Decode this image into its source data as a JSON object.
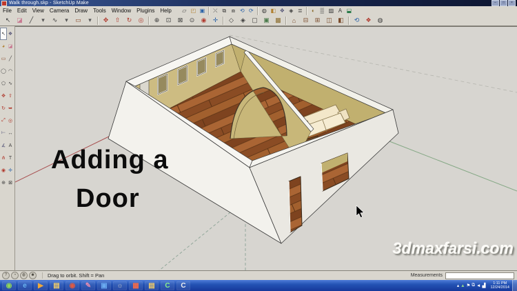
{
  "window": {
    "title": "Walk through.skp - SketchUp Make",
    "controls": [
      {
        "name": "minimize-button",
        "glyph": "–"
      },
      {
        "name": "maximize-button",
        "glyph": "□"
      },
      {
        "name": "close-button",
        "glyph": "×"
      }
    ]
  },
  "menu_bar": {
    "items": [
      {
        "name": "menu-file",
        "label": "File"
      },
      {
        "name": "menu-edit",
        "label": "Edit"
      },
      {
        "name": "menu-view",
        "label": "View"
      },
      {
        "name": "menu-camera",
        "label": "Camera"
      },
      {
        "name": "menu-draw",
        "label": "Draw"
      },
      {
        "name": "menu-tools",
        "label": "Tools"
      },
      {
        "name": "menu-window",
        "label": "Window"
      },
      {
        "name": "menu-plugins",
        "label": "Plugins"
      },
      {
        "name": "menu-help",
        "label": "Help"
      }
    ]
  },
  "toolbar_row1": {
    "icons": [
      {
        "name": "new-icon",
        "glyph": "▱"
      },
      {
        "name": "open-icon",
        "glyph": "◰",
        "color": "#b08030"
      },
      {
        "name": "save-icon",
        "glyph": "▣",
        "color": "#2a62a8"
      },
      {
        "sep": true,
        "name": "separator"
      },
      {
        "name": "cut-icon",
        "glyph": "⤫"
      },
      {
        "name": "copy-icon",
        "glyph": "⧉"
      },
      {
        "name": "paste-icon",
        "glyph": "⧈"
      },
      {
        "name": "undo-icon",
        "glyph": "⟲",
        "color": "#2a62a8"
      },
      {
        "name": "redo-icon",
        "glyph": "⟳",
        "color": "#2a62a8"
      },
      {
        "sep": true,
        "name": "separator"
      },
      {
        "name": "model-info-icon",
        "glyph": "◍"
      },
      {
        "name": "materials-icon",
        "glyph": "◧",
        "color": "#b08030"
      },
      {
        "name": "components-icon",
        "glyph": "❖",
        "color": "#555577"
      },
      {
        "name": "styles-icon",
        "glyph": "◈"
      },
      {
        "name": "layers-icon",
        "glyph": "≣"
      },
      {
        "sep": true,
        "name": "separator"
      },
      {
        "name": "shadows-icon",
        "glyph": "◐",
        "color": "#8a6a2a"
      },
      {
        "name": "fog-icon",
        "glyph": "▒"
      },
      {
        "name": "match-photo-icon",
        "glyph": "▨"
      },
      {
        "name": "text-tool-icon",
        "glyph": "A"
      },
      {
        "name": "section-plane-icon",
        "glyph": "⬓",
        "color": "#2a7a4a"
      }
    ]
  },
  "toolbar_row2": {
    "icons": [
      {
        "name": "select-icon",
        "glyph": "↖"
      },
      {
        "name": "eraser-icon",
        "glyph": "◪",
        "color": "#c87a92"
      },
      {
        "name": "line-icon",
        "glyph": "╱"
      },
      {
        "name": "dropdown-icon",
        "glyph": "▾",
        "color": "#555"
      },
      {
        "name": "freehand-icon",
        "glyph": "∿"
      },
      {
        "name": "dropdown-icon",
        "glyph": "▾",
        "color": "#555"
      },
      {
        "name": "rectangle-icon",
        "glyph": "▭",
        "color": "#8a4a2a"
      },
      {
        "name": "dropdown-icon",
        "glyph": "▾",
        "color": "#555"
      },
      {
        "sep": true,
        "name": "separator"
      },
      {
        "name": "move-icon",
        "glyph": "✥",
        "color": "#b03a2e"
      },
      {
        "name": "push-pull-icon",
        "glyph": "⇧",
        "color": "#b03a2e"
      },
      {
        "name": "rotate-icon",
        "glyph": "↻",
        "color": "#b03a2e"
      },
      {
        "name": "offset-icon",
        "glyph": "◎",
        "color": "#b03a2e"
      },
      {
        "sep": true,
        "name": "separator"
      },
      {
        "name": "zoom-in-icon",
        "glyph": "⊕"
      },
      {
        "name": "zoom-window-icon",
        "glyph": "⊡"
      },
      {
        "name": "zoom-extents-icon",
        "glyph": "⊠"
      },
      {
        "name": "zoom-previous-icon",
        "glyph": "⊙"
      },
      {
        "name": "orbit-icon",
        "glyph": "◉",
        "color": "#b03a2e"
      },
      {
        "name": "pan-icon",
        "glyph": "✛",
        "color": "#2a62a8"
      },
      {
        "sep": true,
        "name": "separator"
      },
      {
        "name": "xray-icon",
        "glyph": "◇"
      },
      {
        "name": "wireframe-icon",
        "glyph": "◈"
      },
      {
        "name": "hidden-line-icon",
        "glyph": "▢"
      },
      {
        "name": "shaded-icon",
        "glyph": "▣",
        "color": "#4a7a4a"
      },
      {
        "name": "textured-icon",
        "glyph": "▩",
        "color": "#8a6a2a"
      },
      {
        "sep": true,
        "name": "separator"
      },
      {
        "name": "iso-view-icon",
        "glyph": "⌂",
        "color": "#7a4a2a"
      },
      {
        "name": "top-view-icon",
        "glyph": "⊟",
        "color": "#7a4a2a"
      },
      {
        "name": "front-view-icon",
        "glyph": "⊞",
        "color": "#7a4a2a"
      },
      {
        "name": "right-view-icon",
        "glyph": "◫",
        "color": "#7a4a2a"
      },
      {
        "name": "back-view-icon",
        "glyph": "◧",
        "color": "#7a4a2a"
      },
      {
        "sep": true,
        "name": "separator"
      },
      {
        "name": "undo-view-icon",
        "glyph": "⟲",
        "color": "#2a62a8"
      },
      {
        "name": "make-component-icon",
        "glyph": "❖",
        "color": "#b03a2e"
      },
      {
        "name": "model-info-icon",
        "glyph": "◍"
      }
    ]
  },
  "left_toolbar": {
    "icons": [
      {
        "name": "select-icon",
        "glyph": "↖",
        "active": true
      },
      {
        "name": "make-component-icon",
        "glyph": "❖",
        "color": "#555577"
      },
      {
        "name": "paint-bucket-icon",
        "glyph": "◕",
        "color": "#b08030"
      },
      {
        "name": "eraser-icon",
        "glyph": "◪",
        "color": "#c87a92"
      },
      {
        "name": "rectangle-icon",
        "glyph": "▭",
        "color": "#8a4a2a"
      },
      {
        "name": "line-icon",
        "glyph": "╱"
      },
      {
        "name": "circle-icon",
        "glyph": "◯"
      },
      {
        "name": "arc-icon",
        "glyph": "◠"
      },
      {
        "name": "polygon-icon",
        "glyph": "⬠"
      },
      {
        "name": "freehand-icon",
        "glyph": "∿"
      },
      {
        "name": "move-icon",
        "glyph": "✥",
        "color": "#b03a2e"
      },
      {
        "name": "push-pull-icon",
        "glyph": "⇧",
        "color": "#b03a2e"
      },
      {
        "name": "rotate-icon",
        "glyph": "↻",
        "color": "#b03a2e"
      },
      {
        "name": "follow-me-icon",
        "glyph": "➥",
        "color": "#b03a2e"
      },
      {
        "name": "scale-icon",
        "glyph": "⤢",
        "color": "#b03a2e"
      },
      {
        "name": "offset-icon",
        "glyph": "◎",
        "color": "#b03a2e"
      },
      {
        "name": "tape-measure-icon",
        "glyph": "⟝",
        "color": "#555577"
      },
      {
        "name": "dimension-icon",
        "glyph": "↔"
      },
      {
        "name": "protractor-icon",
        "glyph": "∡",
        "color": "#555577"
      },
      {
        "name": "text-icon",
        "glyph": "A"
      },
      {
        "name": "axes-icon",
        "glyph": "⋔",
        "color": "#b03a2e"
      },
      {
        "name": "3d-text-icon",
        "glyph": "T"
      },
      {
        "name": "orbit-icon",
        "glyph": "◉",
        "color": "#b03a2e"
      },
      {
        "name": "pan-icon",
        "glyph": "✛",
        "color": "#2a62a8"
      },
      {
        "name": "zoom-icon",
        "glyph": "⊕"
      },
      {
        "name": "zoom-extents-icon",
        "glyph": "⊠"
      }
    ]
  },
  "canvas": {
    "overlay_title_line1": "Adding a",
    "overlay_title_line2": "Door",
    "watermark": "3dmaxfarsi.com",
    "colors": {
      "background": "#d7d5d0",
      "wall_interior_lit": "#cdbc82",
      "wall_interior_shaded": "#c1b06f",
      "wall_exterior": "#f3f2ed",
      "wall_rim": "#f7f6f2",
      "floor_wood_base": "#9a5a2c",
      "sofa_cream": "#f3e7c9",
      "table_brown": "#6b4423",
      "axis_red": "#a85050",
      "axis_green": "#85a885",
      "axis_dashed": "#93a89b"
    }
  },
  "status_bar": {
    "icons": [
      {
        "name": "help-icon",
        "glyph": "?"
      },
      {
        "name": "credits-icon",
        "glyph": "◔"
      },
      {
        "name": "geolocation-icon",
        "glyph": "◍"
      },
      {
        "name": "account-icon",
        "glyph": "☻"
      }
    ],
    "hint": "Drag to orbit. Shift = Pan",
    "measurements_label": "Measurements",
    "measurements_value": ""
  },
  "taskbar": {
    "items": [
      {
        "name": "start-button",
        "glyph": "◉",
        "color": "#8fd45a"
      },
      {
        "name": "internet-explorer-icon",
        "glyph": "e",
        "color": "#6ab4f0"
      },
      {
        "name": "media-player-icon",
        "glyph": "▶",
        "color": "#f0a83a"
      },
      {
        "name": "folder-icon",
        "glyph": "▤",
        "color": "#f0cc6a"
      },
      {
        "name": "chrome-icon",
        "glyph": "◉",
        "color": "#e05a42"
      },
      {
        "name": "snipping-tool-icon",
        "glyph": "✎",
        "color": "#e08ab0"
      },
      {
        "name": "dropbox-icon",
        "glyph": "▣",
        "color": "#6aaaf0"
      },
      {
        "name": "settings-icon",
        "glyph": "☼",
        "color": "#c8c8c8"
      },
      {
        "name": "powerpoint-icon",
        "glyph": "▦",
        "color": "#f06a4a"
      },
      {
        "name": "documents-folder-icon",
        "glyph": "▤",
        "color": "#f0cc6a"
      },
      {
        "name": "camtasia-icon",
        "glyph": "C",
        "color": "#8af08a"
      },
      {
        "name": "camtasia-editor-icon",
        "glyph": "C",
        "color": "#f0f0f0"
      }
    ],
    "tray_icons": [
      {
        "name": "tray-chevron-icon",
        "glyph": "▴",
        "color": "#ffffff"
      },
      {
        "name": "vpn-icon",
        "glyph": "▲",
        "color": "#8fd48f"
      },
      {
        "name": "flag-icon",
        "glyph": "⚑",
        "color": "#ffffff"
      },
      {
        "name": "display-icon",
        "glyph": "⧉",
        "color": "#ffffff"
      },
      {
        "name": "volume-icon",
        "glyph": "◄",
        "color": "#ffffff"
      },
      {
        "name": "network-icon",
        "glyph": "▟",
        "color": "#ffffff"
      }
    ],
    "clock": {
      "time": "1:11 PM",
      "date": "12/24/2014"
    }
  }
}
